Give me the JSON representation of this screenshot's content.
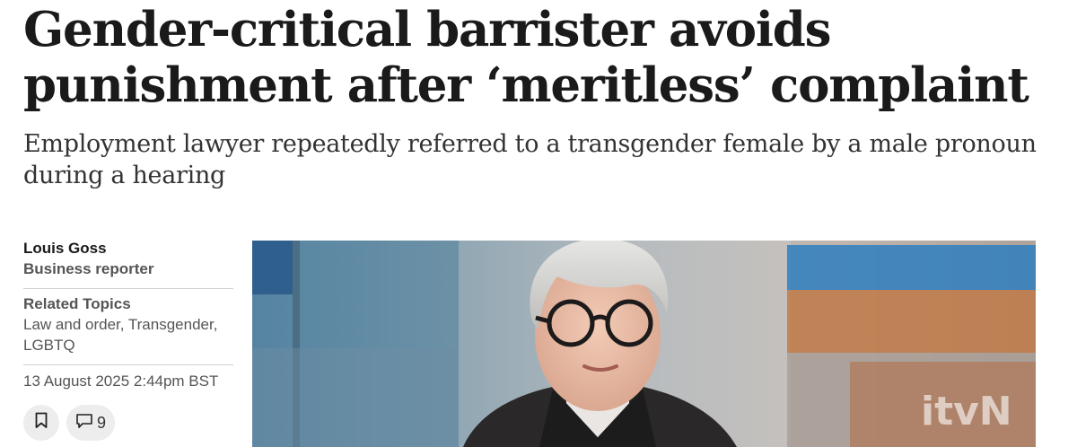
{
  "article": {
    "headline": "Gender-critical barrister avoids punishment after ‘meritless’ complaint",
    "standfirst": "Employment lawyer repeatedly referred to a transgender female by a male pronoun during a hearing"
  },
  "byline": {
    "author_name": "Louis Goss",
    "author_role": "Business reporter",
    "topics_title": "Related Topics",
    "topics": "Law and order, Transgender, LGBTQ",
    "date": "13 August 2025 2:44pm BST"
  },
  "actions": {
    "bookmark_icon": "bookmark-icon",
    "comments_icon": "comment-icon",
    "comments_count": "9"
  },
  "image": {
    "watermark": "itvN"
  }
}
